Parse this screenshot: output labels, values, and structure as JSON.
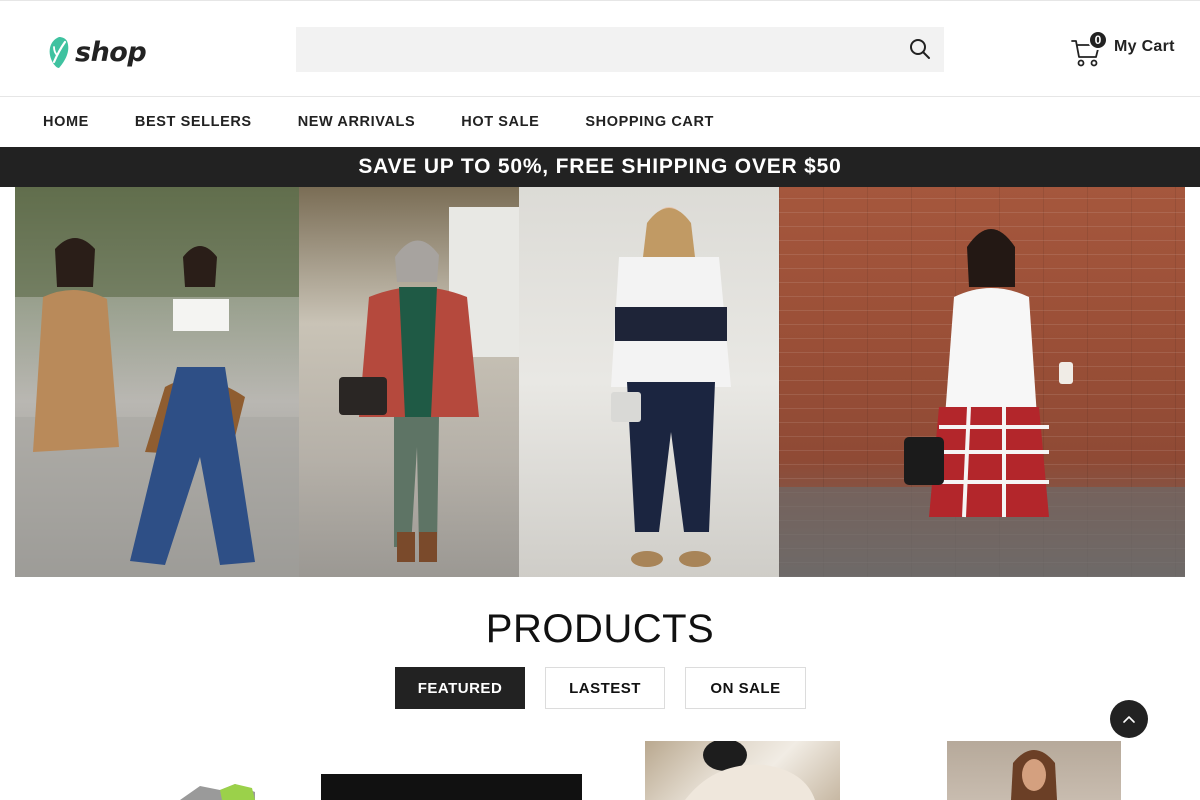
{
  "brand": {
    "logo_text": "shop",
    "accent": "#3fc2a0"
  },
  "search": {
    "placeholder": "",
    "icon": "search-icon"
  },
  "cart": {
    "count": "0",
    "label": "My Cart",
    "icon": "cart-icon"
  },
  "nav": {
    "items": [
      {
        "label": "HOME"
      },
      {
        "label": "BEST SELLERS"
      },
      {
        "label": "NEW ARRIVALS"
      },
      {
        "label": "HOT SALE"
      },
      {
        "label": "SHOPPING CART"
      }
    ]
  },
  "promo": {
    "text": "SAVE UP TO 50%, FREE SHIPPING OVER $50",
    "background": "#222222"
  },
  "products": {
    "title": "PRODUCTS",
    "tabs": [
      {
        "label": "FEATURED",
        "active": true
      },
      {
        "label": "LASTEST",
        "active": false
      },
      {
        "label": "ON SALE",
        "active": false
      }
    ]
  },
  "back_to_top": {
    "icon": "chevron-up-icon"
  }
}
